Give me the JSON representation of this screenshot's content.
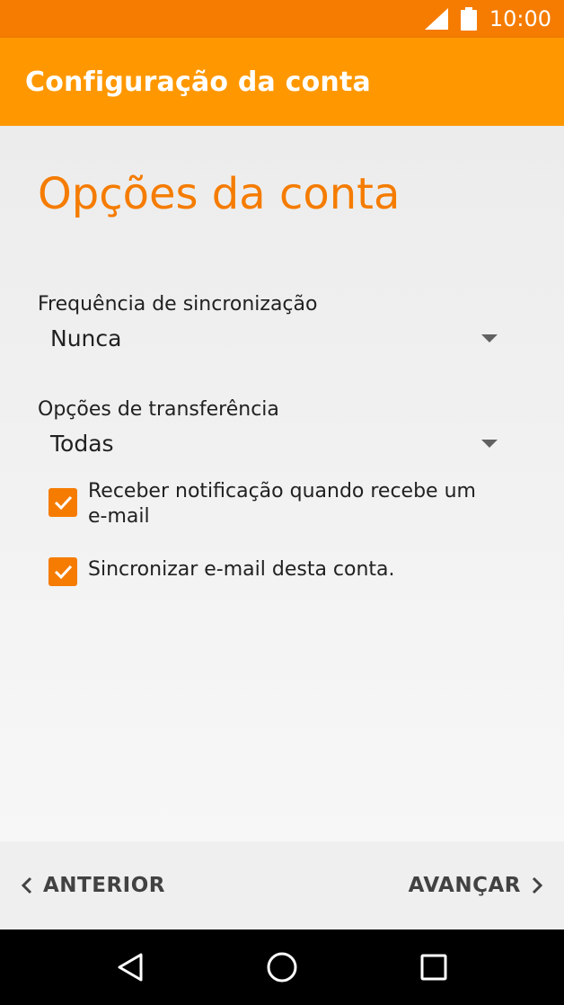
{
  "status_bar": {
    "time": "10:00"
  },
  "app_bar": {
    "title": "Configuração da conta"
  },
  "section": {
    "title": "Opções da conta"
  },
  "sync_frequency": {
    "label": "Frequência de sincronização",
    "value": "Nunca"
  },
  "transfer_options": {
    "label": "Opções de transferência",
    "value": "Todas"
  },
  "checkboxes": [
    {
      "label": "Receber notificação quando recebe um e-mail",
      "checked": true
    },
    {
      "label": "Sincronizar e-mail desta conta.",
      "checked": true
    }
  ],
  "footer": {
    "back_label": "ANTERIOR",
    "next_label": "AVANÇAR"
  },
  "colors": {
    "status_bar": "#f57c00",
    "app_bar": "#ff9800",
    "accent": "#f57c00"
  }
}
